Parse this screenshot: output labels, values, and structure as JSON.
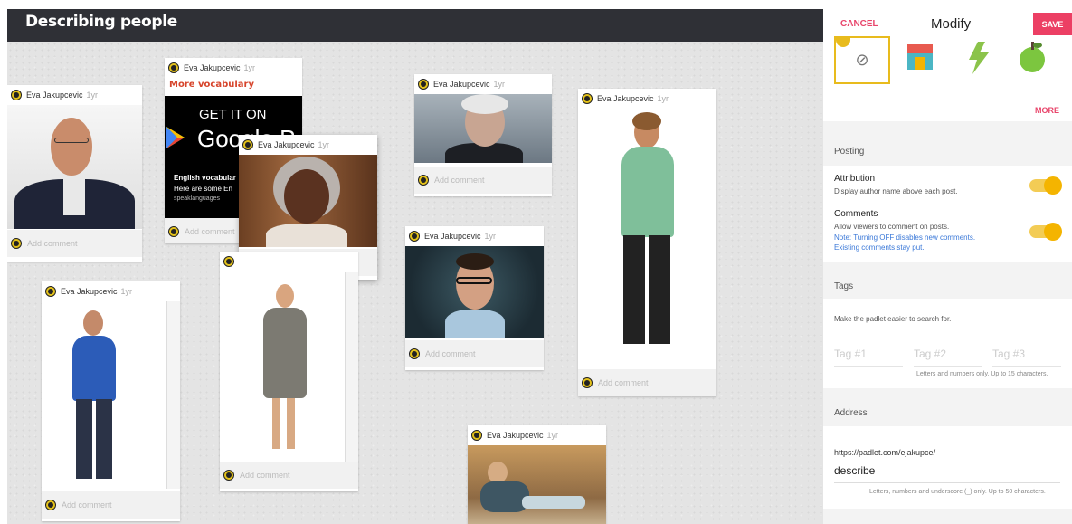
{
  "board": {
    "title": "Describing people"
  },
  "author": {
    "name": "Eva Jakupcevic",
    "ago": "1yr"
  },
  "comment_placeholder": "Add comment",
  "google_card": {
    "subject": "More vocabulary",
    "get_it_on": "GET IT ON",
    "store": "Google P",
    "desc_title": "English vocabular",
    "desc_line": "Here are some En",
    "domain": "speaklanguages"
  },
  "panel": {
    "cancel": "CANCEL",
    "title": "Modify",
    "save": "SAVE",
    "more": "MORE",
    "posting": {
      "title": "Posting",
      "attribution_label": "Attribution",
      "attribution_desc": "Display author name above each post.",
      "attribution_on": true,
      "comments_label": "Comments",
      "comments_desc": "Allow viewers to comment on posts.",
      "comments_note1": "Note: Turning OFF disables new comments.",
      "comments_note2": "Existing comments stay put.",
      "comments_on": true
    },
    "tags": {
      "title": "Tags",
      "desc": "Make the padlet easier to search for.",
      "placeholders": [
        "Tag #1",
        "Tag #2",
        "Tag #3"
      ],
      "hint": "Letters and numbers only. Up to 15 characters."
    },
    "address": {
      "title": "Address",
      "prefix": "https://padlet.com/ejakupce/",
      "value": "describe",
      "hint": "Letters, numbers and underscore (_) only. Up to 50 characters."
    }
  },
  "colors": {
    "accent": "#ec3f64",
    "toggle": "#f4b400",
    "header": "#2f3036",
    "note": "#3a78d8"
  }
}
